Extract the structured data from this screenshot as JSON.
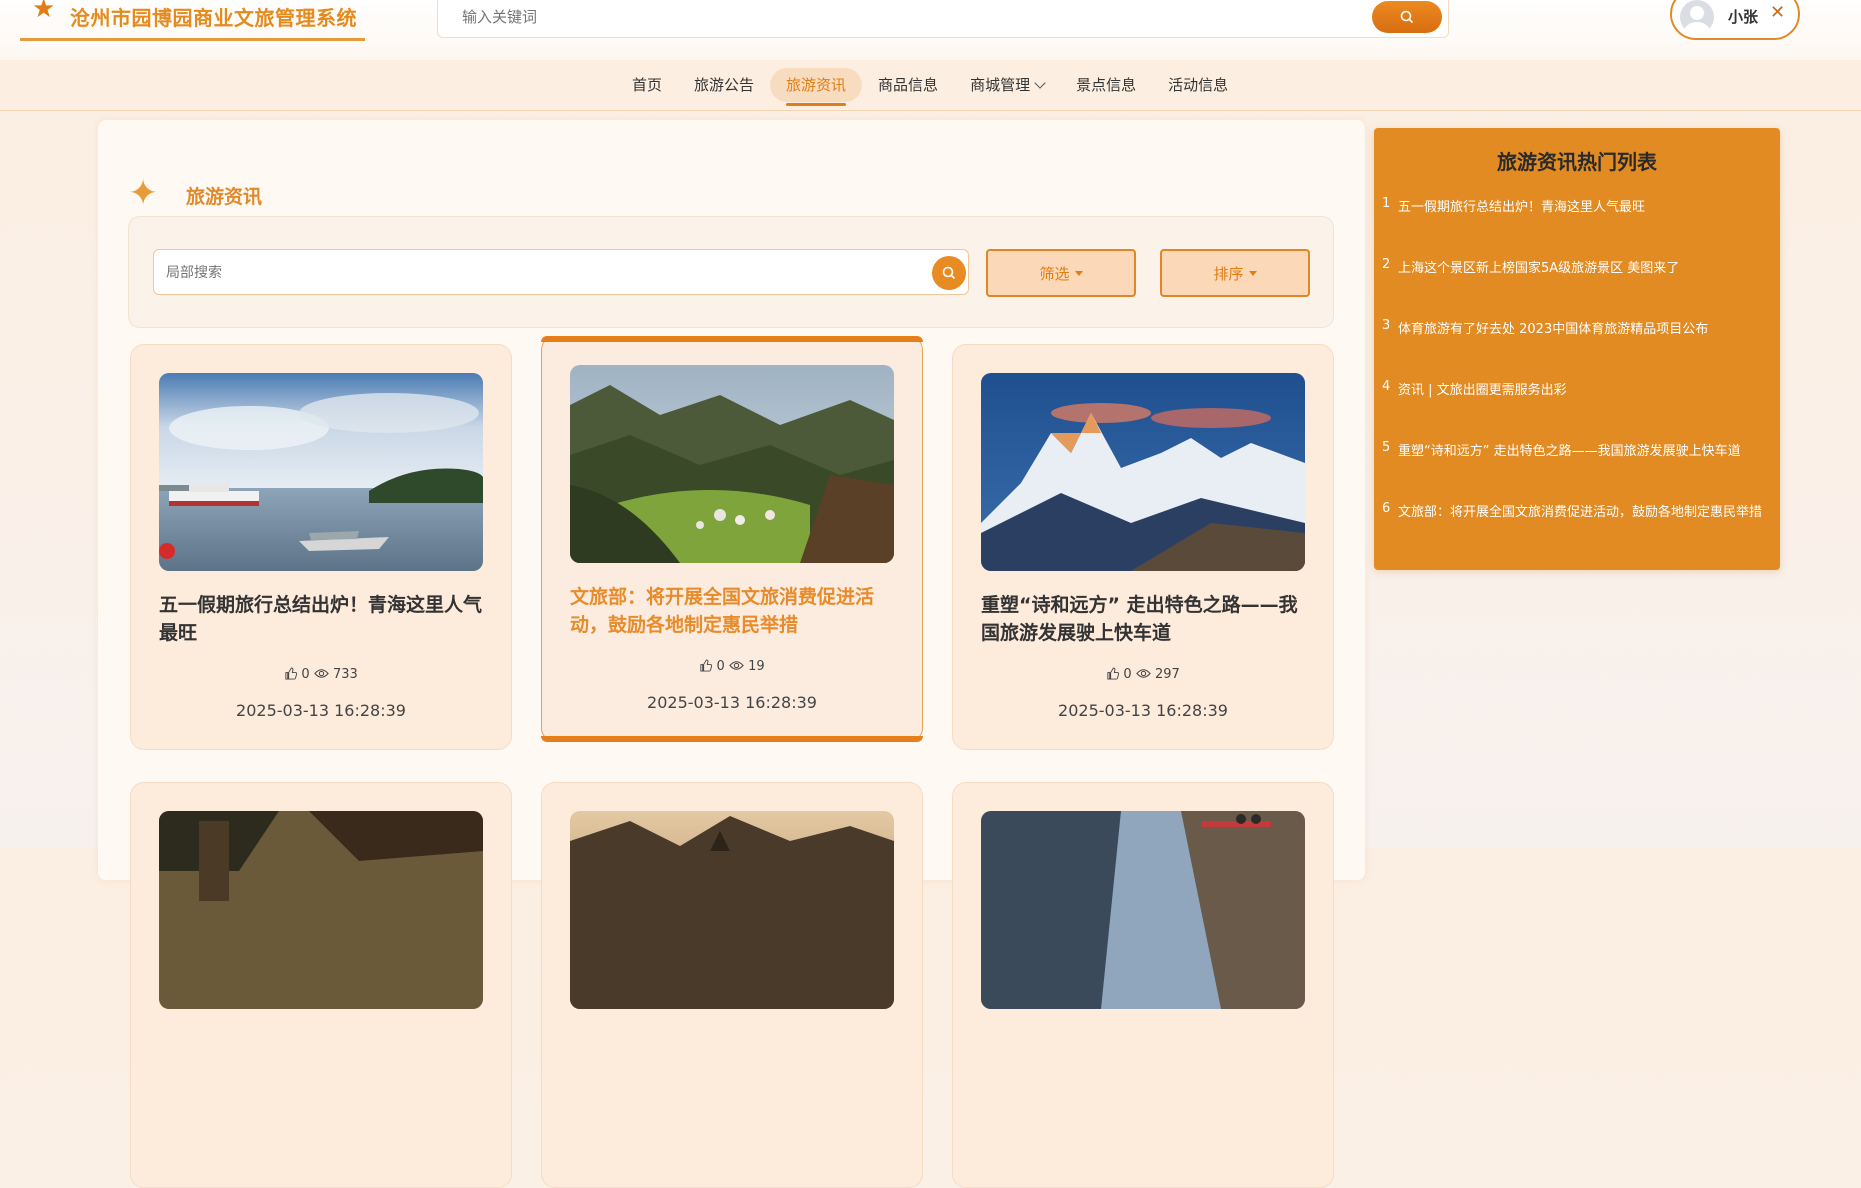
{
  "header": {
    "site_title": "沧州市园博园商业文旅管理系统",
    "search_placeholder": "输入关键词",
    "user_name": "小张"
  },
  "nav": {
    "items": [
      {
        "label": "首页"
      },
      {
        "label": "旅游公告"
      },
      {
        "label": "旅游资讯",
        "active": true
      },
      {
        "label": "商品信息"
      },
      {
        "label": "商城管理",
        "dropdown": true
      },
      {
        "label": "景点信息"
      },
      {
        "label": "活动信息"
      }
    ]
  },
  "section": {
    "title": "旅游资讯",
    "local_search_placeholder": "局部搜索",
    "filter_label": "筛选",
    "sort_label": "排序"
  },
  "cards": [
    {
      "title": "五一假期旅行总结出炉！青海这里人气最旺",
      "likes": "0",
      "views": "733",
      "date": "2025-03-13 16:28:39",
      "image": "lake-with-boats"
    },
    {
      "title": "文旅部：将开展全国文旅消费促进活动，鼓励各地制定惠民举措",
      "likes": "0",
      "views": "19",
      "date": "2025-03-13 16:28:39",
      "image": "forest-valley"
    },
    {
      "title": "重塑“诗和远方” 走出特色之路——我国旅游发展驶上快车道",
      "likes": "0",
      "views": "297",
      "date": "2025-03-13 16:28:39",
      "image": "snow-mountains"
    }
  ],
  "hot_list": {
    "title": "旅游资讯热门列表",
    "items": [
      {
        "rank": "1",
        "text": "五一假期旅行总结出炉！青海这里人气最旺"
      },
      {
        "rank": "2",
        "text": "上海这个景区新上榜国家5A级旅游景区 美图来了"
      },
      {
        "rank": "3",
        "text": "体育旅游有了好去处 2023中国体育旅游精品项目公布"
      },
      {
        "rank": "4",
        "text": "资讯 | 文旅出圈更需服务出彩"
      },
      {
        "rank": "5",
        "text": "重塑“诗和远方” 走出特色之路——我国旅游发展驶上快车道"
      },
      {
        "rank": "6",
        "text": "文旅部：将开展全国文旅消费促进活动，鼓励各地制定惠民举措"
      }
    ]
  },
  "colors": {
    "accent": "#e07d14",
    "hot_panel": "#e18b22",
    "card_bg": "#fdebdc"
  }
}
